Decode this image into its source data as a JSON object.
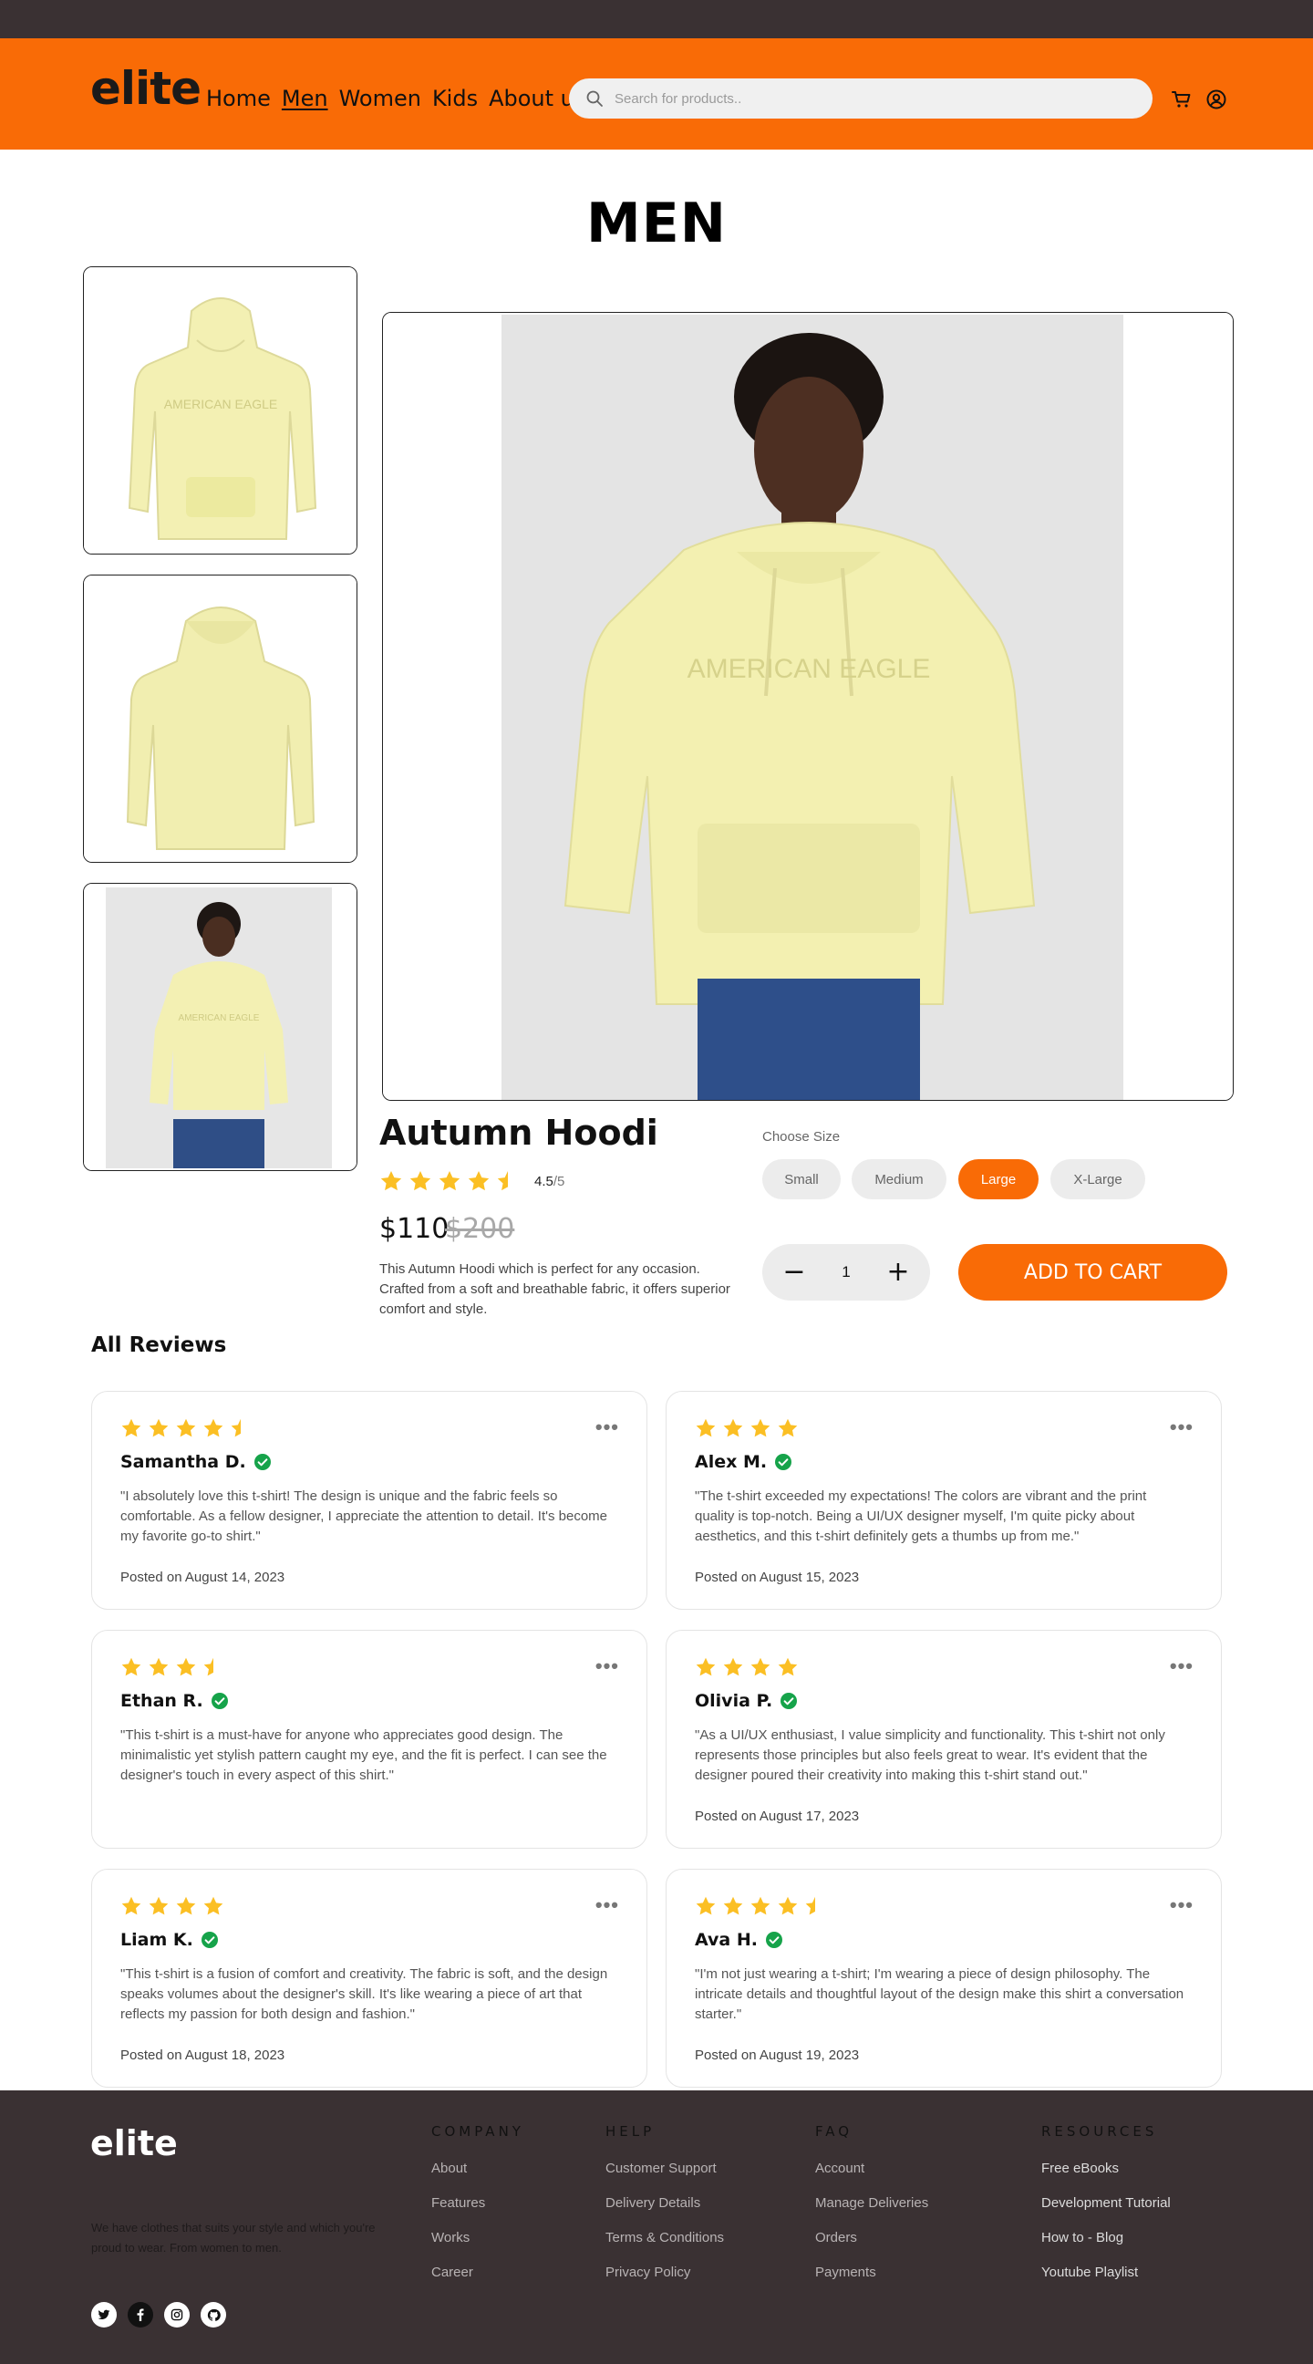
{
  "header": {
    "logo": "elite",
    "nav": [
      {
        "label": "Home",
        "active": false
      },
      {
        "label": "Men",
        "active": true
      },
      {
        "label": "Women",
        "active": false
      },
      {
        "label": "Kids",
        "active": false
      },
      {
        "label": "About us",
        "active": false
      }
    ],
    "search_placeholder": "Search for products..",
    "icons": [
      "search-icon",
      "cart-icon",
      "user-icon"
    ]
  },
  "page_title": "MEN",
  "product": {
    "name": "Autumn Hoodi",
    "rating": "4.5",
    "rating_max": "/5",
    "rating_value": 4.5,
    "price": "$110",
    "old_price": "$200",
    "description": "This Autumn Hoodi which is perfect for any occasion. Crafted from a soft and breathable fabric, it offers superior comfort and style.",
    "choose_size_label": "Choose Size",
    "sizes": [
      "Small",
      "Medium",
      "Large",
      "X-Large"
    ],
    "selected_size": "Large",
    "quantity": "1",
    "add_to_cart": "ADD TO CART"
  },
  "reviews_title": "All Reviews",
  "reviews": [
    {
      "name": "Samantha D.",
      "stars": 4.5,
      "text": "\"I absolutely love this t-shirt! The design is unique and the fabric feels so comfortable. As a fellow designer, I appreciate the attention to detail. It's become my favorite go-to shirt.\"",
      "date": "Posted on August 14, 2023"
    },
    {
      "name": "Alex M.",
      "stars": 4,
      "text": "\"The t-shirt exceeded my expectations! The colors are vibrant and the print quality is top-notch. Being a UI/UX designer myself, I'm quite picky about aesthetics, and this t-shirt definitely gets a thumbs up from me.\"",
      "date": "Posted on August 15, 2023"
    },
    {
      "name": "Ethan R.",
      "stars": 3.5,
      "text": "\"This t-shirt is a must-have for anyone who appreciates good design. The minimalistic yet stylish pattern caught my eye, and the fit is perfect. I can see the designer's touch in every aspect of this shirt.\"",
      "date": ""
    },
    {
      "name": "Olivia P.",
      "stars": 4,
      "text": "\"As a UI/UX enthusiast, I value simplicity and functionality. This t-shirt not only represents those principles but also feels great to wear. It's evident that the designer poured their creativity into making this t-shirt stand out.\"",
      "date": "Posted on August 17, 2023"
    },
    {
      "name": "Liam K.",
      "stars": 4,
      "text": "\"This t-shirt is a fusion of comfort and creativity. The fabric is soft, and the design speaks volumes about the designer's skill. It's like wearing a piece of art that reflects my passion for both design and fashion.\"",
      "date": "Posted on August 18, 2023"
    },
    {
      "name": "Ava H.",
      "stars": 4.5,
      "text": "\"I'm not just wearing a t-shirt; I'm wearing a piece of design philosophy. The intricate details and thoughtful layout of the design make this shirt a conversation starter.\"",
      "date": "Posted on August 19, 2023"
    }
  ],
  "footer": {
    "logo": "elite",
    "tagline": "We have clothes that suits your style and which you're proud to wear. From women to men.",
    "social": [
      "twitter-icon",
      "facebook-icon",
      "instagram-icon",
      "github-icon"
    ],
    "columns": [
      {
        "title": "COMPANY",
        "links": [
          "About",
          "Features",
          "Works",
          "Career"
        ]
      },
      {
        "title": "HELP",
        "links": [
          "Customer Support",
          "Delivery Details",
          "Terms & Conditions",
          "Privacy Policy"
        ]
      },
      {
        "title": "FAQ",
        "links": [
          "Account",
          "Manage Deliveries",
          "Orders",
          "Payments"
        ]
      },
      {
        "title": "RESOURCES",
        "links": [
          "Free eBooks",
          "Development Tutorial",
          "How to - Blog",
          "Youtube Playlist"
        ]
      }
    ]
  },
  "colors": {
    "accent": "#f96b06",
    "dark": "#3a3133",
    "star": "#fbbf24",
    "verified": "#16a34a"
  }
}
